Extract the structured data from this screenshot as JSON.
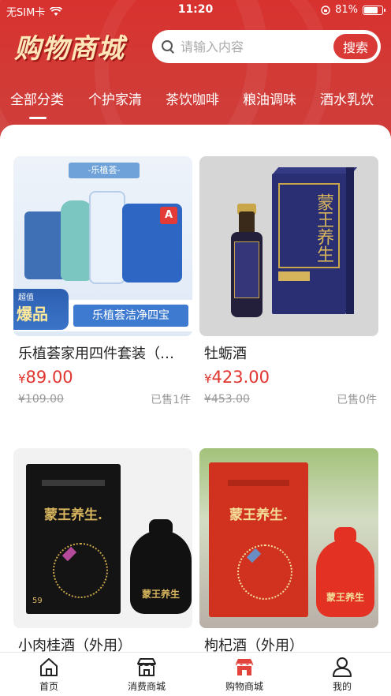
{
  "status_bar": {
    "carrier": "无SIM卡",
    "time": "11:20",
    "battery": "81%",
    "battery_level": 0.81
  },
  "header": {
    "logo_text": "购物商城",
    "search": {
      "placeholder": "请输入内容",
      "button_label": "搜索"
    }
  },
  "tabs": [
    {
      "label": "全部分类",
      "active": true
    },
    {
      "label": "个护家清",
      "active": false
    },
    {
      "label": "茶饮咖啡",
      "active": false
    },
    {
      "label": "粮油调味",
      "active": false
    },
    {
      "label": "酒水乳饮",
      "active": false
    }
  ],
  "products": [
    {
      "name": "乐植荟家用四件套装（…",
      "price_symbol": "¥",
      "price": "89.00",
      "original_price": "¥109.00",
      "sold": "已售1件",
      "image_text": {
        "banner": "-乐植荟-",
        "badge_small": "超值",
        "badge_big": "爆品",
        "slogan": "乐植荟洁净四宝",
        "pack_letter": "A"
      }
    },
    {
      "name": "牡蛎酒",
      "price_symbol": "¥",
      "price": "423.00",
      "original_price": "¥453.00",
      "sold": "已售0件",
      "image_text": {
        "box_title": "蒙王养生"
      }
    },
    {
      "name": "小肉桂酒（外用）",
      "image_text": {
        "box_title": "蒙王养生.",
        "box_number": "59",
        "bottle_text": "蒙王养生"
      }
    },
    {
      "name": "枸杞酒（外用）",
      "image_text": {
        "box_title": "蒙王养生.",
        "bottle_text": "蒙王养生"
      }
    }
  ],
  "tabbar": [
    {
      "label": "首页",
      "icon": "home-icon"
    },
    {
      "label": "消费商城",
      "icon": "store-icon"
    },
    {
      "label": "购物商城",
      "icon": "shop-icon",
      "active": true
    },
    {
      "label": "我的",
      "icon": "user-icon"
    }
  ],
  "colors": {
    "brand_red": "#d8322f",
    "price_red": "#e0362f",
    "logo_gold": "#ffe6b8"
  }
}
